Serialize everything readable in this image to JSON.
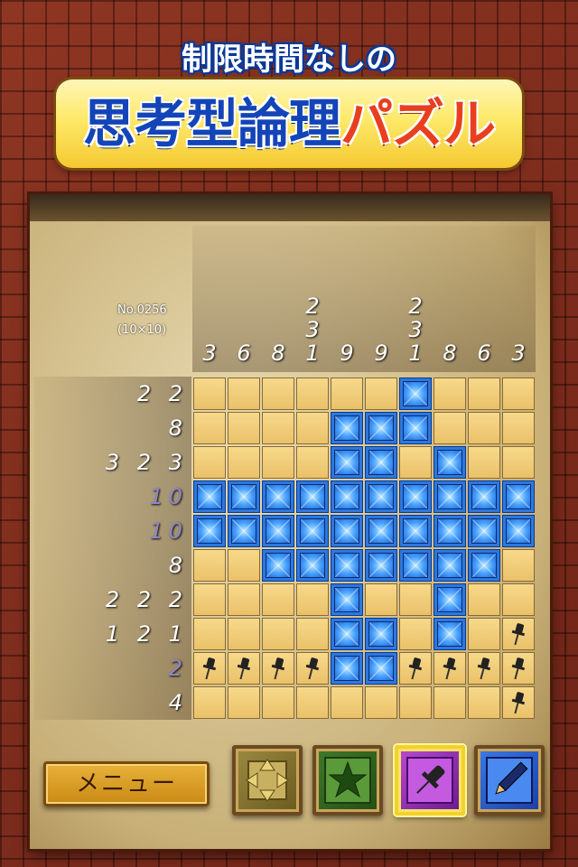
{
  "header": {
    "subtitle": "制限時間なしの",
    "title_part1": "思考型論理",
    "title_part2": "パズル"
  },
  "puzzle": {
    "number": "No.0256",
    "size": "(10×10)",
    "column_clues": [
      [
        "3"
      ],
      [
        "6"
      ],
      [
        "8"
      ],
      [
        "2",
        "3",
        "1"
      ],
      [
        "9"
      ],
      [
        "9"
      ],
      [
        "2",
        "3",
        "1"
      ],
      [
        "8"
      ],
      [
        "6"
      ],
      [
        "3"
      ]
    ],
    "row_clues": [
      "2 2",
      "8",
      "3 2 3",
      "10",
      "10",
      "8",
      "2 2 2",
      "1 2 1",
      "2",
      "4"
    ],
    "completed_rows": [
      3,
      4,
      8
    ],
    "grid": [
      "......F...",
      "....FFF...",
      "....FF.F..",
      "FFFFFFFFFF",
      "FFFFFFFFFF",
      "..FFFFFFF.",
      "....F..F..",
      "....FF.F.P",
      "PPPPFFPPPP",
      ".........P"
    ]
  },
  "toolbar": {
    "menu_label": "メニュー",
    "tools": [
      {
        "name": "move",
        "icon": "move-arrows-icon",
        "selected": false
      },
      {
        "name": "star",
        "icon": "star-icon",
        "selected": false
      },
      {
        "name": "pin",
        "icon": "pushpin-icon",
        "selected": true
      },
      {
        "name": "pen",
        "icon": "pencil-icon",
        "selected": false
      }
    ]
  },
  "colors": {
    "filled": "#2c78e0",
    "empty": "#f0cd78",
    "accent": "#f3d12a",
    "frame": "#7a2a1c"
  }
}
